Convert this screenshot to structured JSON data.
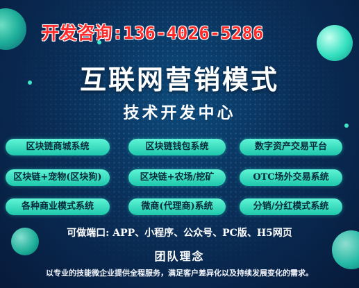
{
  "contact_line": "开发咨询:136-4026-5286",
  "title": "互联网营销模式",
  "subtitle": "技术开发中心",
  "modules": [
    {
      "label": "区块链商城系统"
    },
    {
      "label": "区块链钱包系统"
    },
    {
      "label": "数字资产交易平台"
    },
    {
      "label": "区块链+宠物(区块狗)"
    },
    {
      "label": "区块链+农场/挖矿"
    },
    {
      "label": "OTC场外交易系统"
    },
    {
      "label": "各种商业模式系统"
    },
    {
      "label": "微商(代理商)系统"
    },
    {
      "label": "分销/分红模式系统"
    }
  ],
  "terminals_line": "可做端口: APP、小程序、公众号、PC版、H5网页",
  "team_title": "团队理念",
  "mission_line": "以专业的技能微企业提供全程服务，满足客户差异化以及持续发展变化的需求。",
  "colors": {
    "background": "#0a2f59",
    "pill": "#2ad6b8",
    "contact": "#ff2a2a",
    "text": "#ffffff"
  }
}
